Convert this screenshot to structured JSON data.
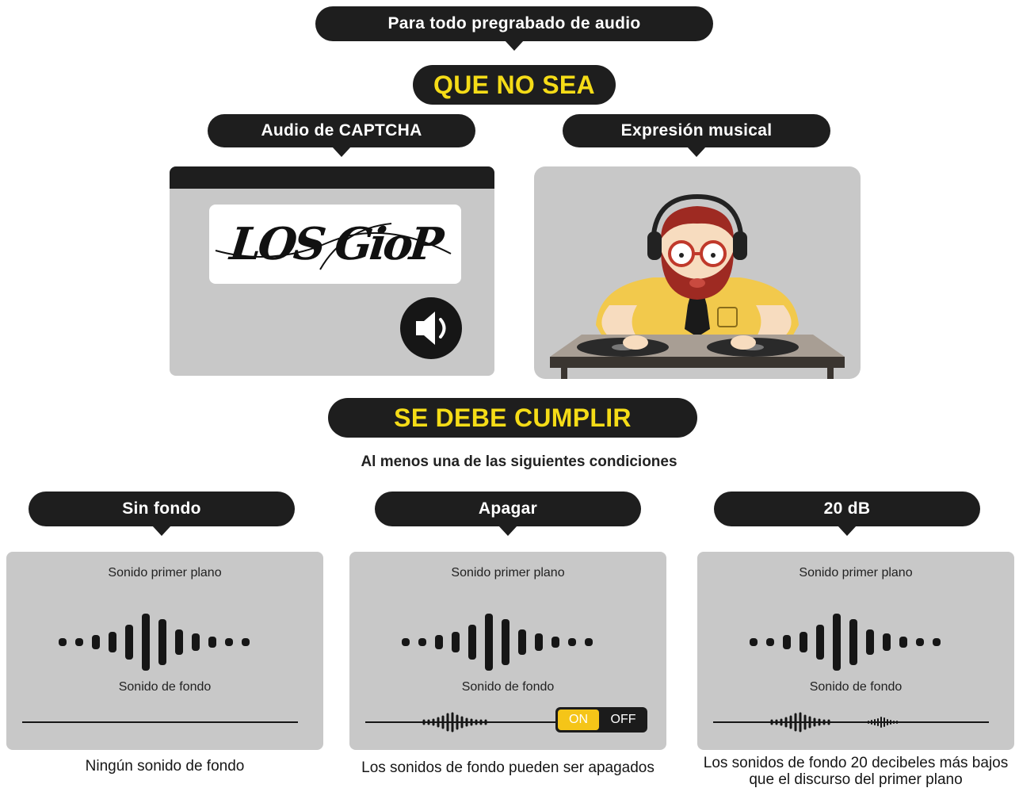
{
  "header": {
    "title": "Para todo pregrabado de audio"
  },
  "exceptions": {
    "heading": "QUE NO SEA",
    "captcha": {
      "label": "Audio de CAPTCHA",
      "captcha_text": "LOS GioP"
    },
    "music": {
      "label": "Expresión musical"
    }
  },
  "requirements": {
    "heading": "SE DEBE CUMPLIR",
    "subtitle": "Al menos una de las siguientes condiciones"
  },
  "conditions": [
    {
      "title": "Sin fondo",
      "foreground_label": "Sonido primer plano",
      "background_label": "Sonido de fondo",
      "caption": "Ningún sonido de fondo"
    },
    {
      "title": "Apagar",
      "foreground_label": "Sonido primer plano",
      "background_label": "Sonido de fondo",
      "toggle_on": "ON",
      "toggle_off": "OFF",
      "caption": "Los sonidos de fondo pueden ser apagados"
    },
    {
      "title": "20 dB",
      "foreground_label": "Sonido primer plano",
      "background_label": "Sonido de fondo",
      "caption_line1": "Los sonidos de fondo 20 decibeles más bajos",
      "caption_line2": "que el discurso del primer plano"
    }
  ],
  "colors": {
    "accent": "#f5dc17",
    "dark": "#1e1e1e",
    "panel": "#c8c8c8"
  }
}
